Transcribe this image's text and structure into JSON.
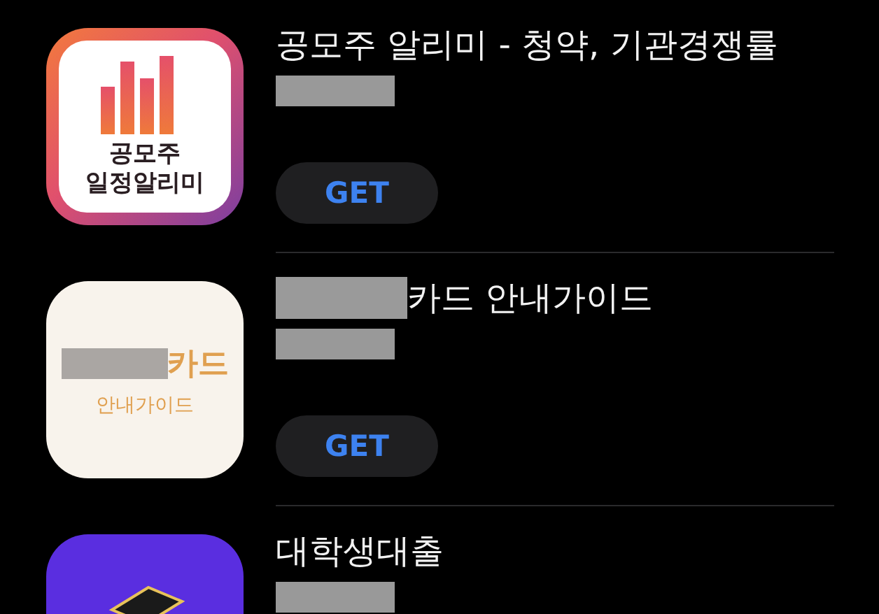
{
  "apps": [
    {
      "title": "공모주 알리미 - 청약, 기관경쟁률",
      "title_redacted": false,
      "subtitle_redacted": true,
      "icon": {
        "kind": "chart",
        "lines": [
          "공모주",
          "일정알리미"
        ]
      },
      "button": "GET"
    },
    {
      "title": "카드 안내가이드",
      "title_redacted": true,
      "subtitle_redacted": true,
      "icon": {
        "kind": "card",
        "lines": [
          "카드",
          "안내가이드"
        ]
      },
      "button": "GET"
    },
    {
      "title": "대학생대출",
      "title_redacted": false,
      "subtitle_redacted": true,
      "icon": {
        "kind": "cap"
      }
    }
  ]
}
